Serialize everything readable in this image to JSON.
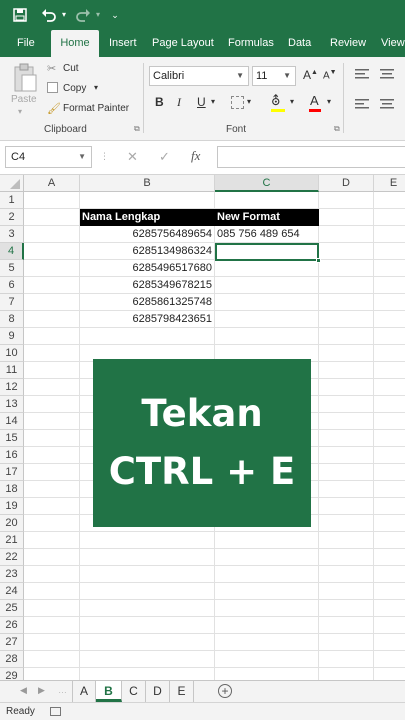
{
  "qat": {
    "save_icon": "save-icon",
    "undo_icon": "undo-icon",
    "redo_icon": "redo-icon"
  },
  "ribbon_tabs": [
    "File",
    "Home",
    "Insert",
    "Page Layout",
    "Formulas",
    "Data",
    "Review",
    "View"
  ],
  "active_tab": "Home",
  "clipboard": {
    "paste": "Paste",
    "cut": "Cut",
    "copy": "Copy",
    "format_painter": "Format Painter",
    "group_label": "Clipboard"
  },
  "font": {
    "name": "Calibri",
    "size": "11",
    "bold": "B",
    "italic": "I",
    "underline": "U",
    "grow": "A",
    "shrink": "A",
    "color": "A",
    "group_label": "Font"
  },
  "formula_bar": {
    "name_box": "C4",
    "cancel": "✕",
    "enter": "✓",
    "fx": "fx",
    "value": ""
  },
  "columns": [
    "A",
    "B",
    "C",
    "D",
    "E"
  ],
  "selected_column": "C",
  "rows": [
    "1",
    "2",
    "3",
    "4",
    "5",
    "6",
    "7",
    "8",
    "9",
    "10",
    "11",
    "12",
    "13",
    "14",
    "15",
    "16",
    "17",
    "18",
    "19",
    "20",
    "21",
    "22",
    "23",
    "24",
    "25",
    "26",
    "27",
    "28",
    "29"
  ],
  "selected_row": "4",
  "table": {
    "header_b": "Nama Lengkap",
    "header_c": "New Format",
    "b_values": [
      "6285756489654",
      "6285134986324",
      "6285496517680",
      "6285349678215",
      "6285861325748",
      "6285798423651"
    ],
    "c3": "085 756 489 654"
  },
  "overlay": {
    "line1": "Tekan",
    "line2": "CTRL + E"
  },
  "sheets": [
    "A",
    "B",
    "C",
    "D",
    "E"
  ],
  "active_sheet": "B",
  "add_sheet": "+",
  "status": {
    "text": "Ready"
  },
  "colors": {
    "brand_green": "#217346",
    "header_black": "#000000"
  }
}
